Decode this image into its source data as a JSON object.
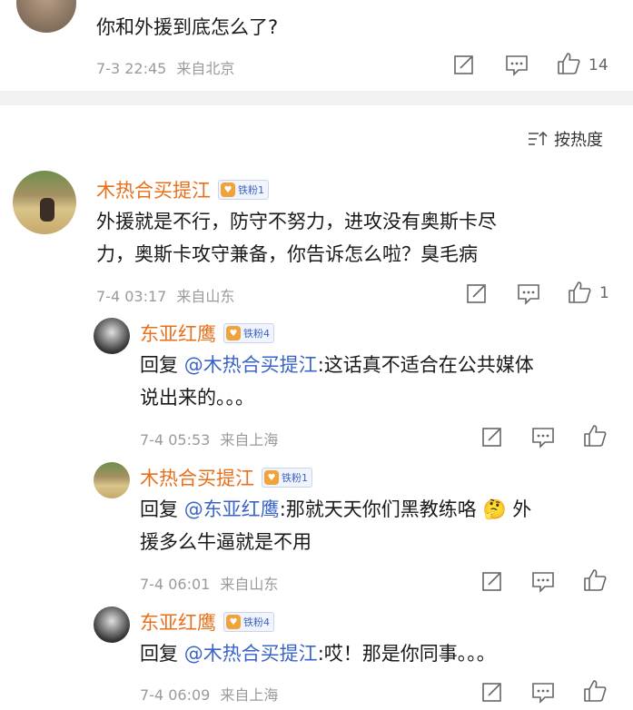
{
  "top_comment": {
    "text": "你和外援到底怎么了?",
    "time": "7-3 22:45",
    "location": "来自北京",
    "like_count": "14"
  },
  "sort_label": "按热度",
  "comments": [
    {
      "user": "木热合买提江",
      "badge": "铁粉1",
      "text_line1": "外援就是不行，防守不努力，进攻没有奥斯卡尽",
      "text_line2": "力，奥斯卡攻守兼备，你告诉怎么啦？臭毛病",
      "time": "7-4 03:17",
      "location": "来自山东",
      "like_count": "1"
    }
  ],
  "replies": [
    {
      "user": "东亚红鹰",
      "badge": "铁粉4",
      "reply_prefix": "回复",
      "mention": "@木热合买提江",
      "text_line1": ":这话真不适合在公共媒体",
      "text_line2": "说出来的。。。",
      "time": "7-4 05:53",
      "location": "来自上海"
    },
    {
      "user": "木热合买提江",
      "badge": "铁粉1",
      "reply_prefix": "回复",
      "mention": "@东亚红鹰",
      "text_line1": ":那就天天你们黑教练咯",
      "emoji": "🤔",
      "text_line1b": "外",
      "text_line2": "援多么牛逼就是不用",
      "time": "7-4 06:01",
      "location": "来自山东"
    },
    {
      "user": "东亚红鹰",
      "badge": "铁粉4",
      "reply_prefix": "回复",
      "mention": "@木热合买提江",
      "text_line1": ":哎！那是你同事。。。",
      "time": "7-4 06:09",
      "location": "来自上海"
    }
  ],
  "icons": {
    "share": "share-icon",
    "comment": "comment-icon",
    "like": "thumbs-up-icon",
    "sort": "sort-icon",
    "badge": "fan-badge-icon"
  }
}
